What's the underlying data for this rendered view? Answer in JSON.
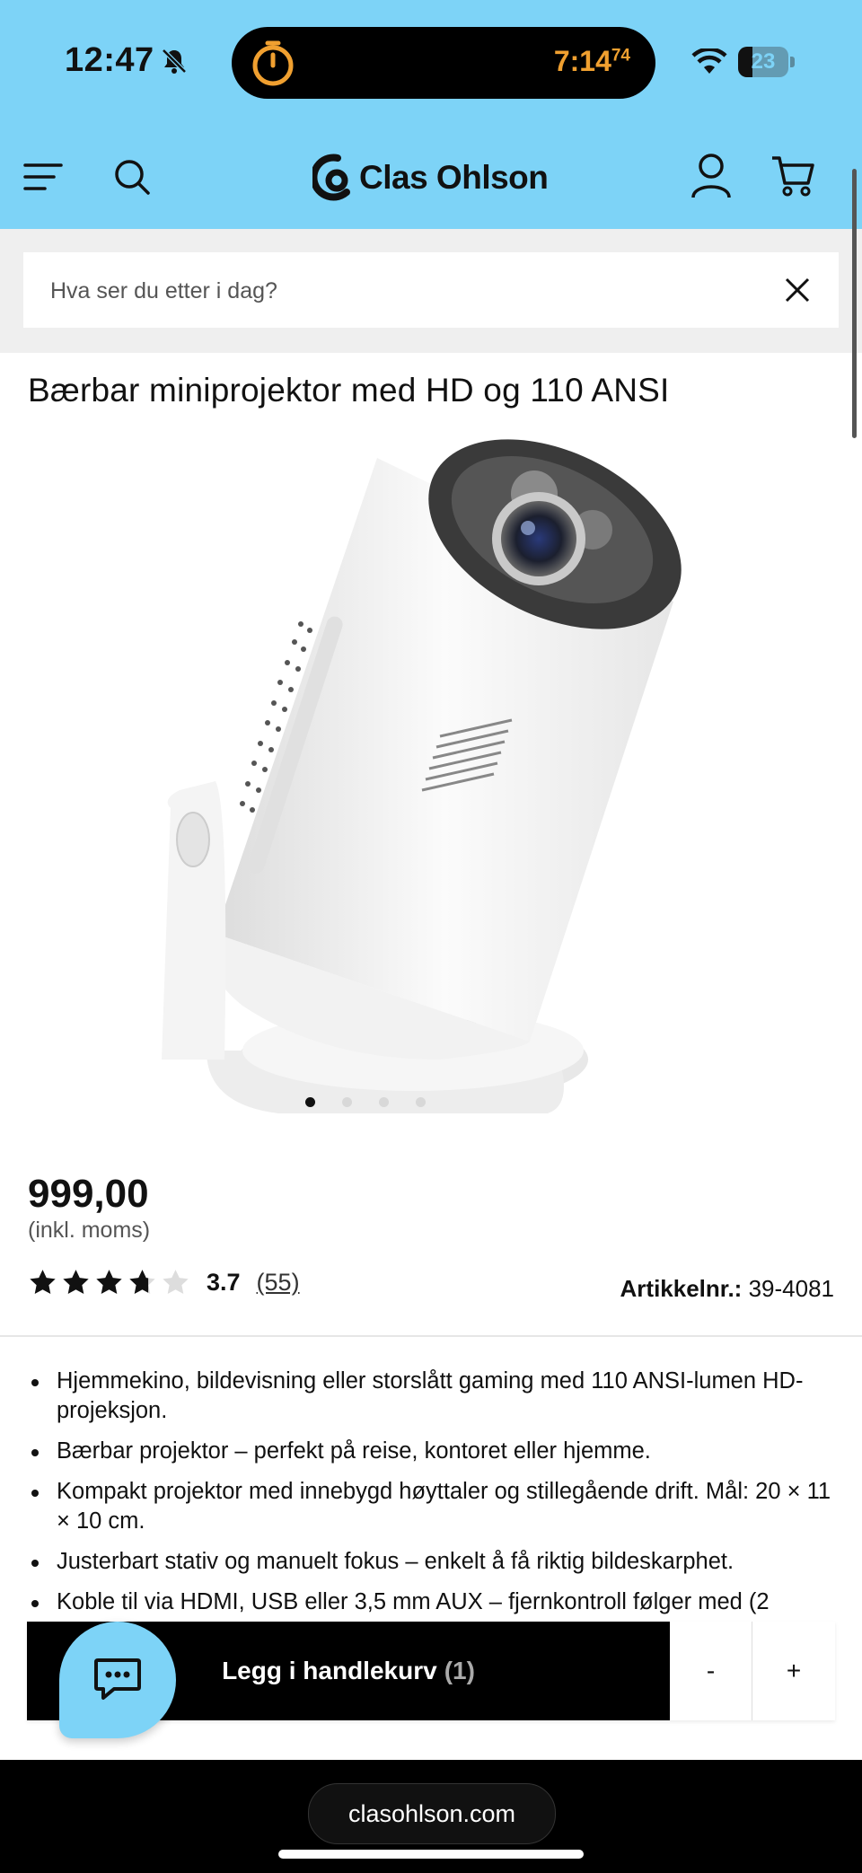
{
  "status_bar": {
    "time": "12:47",
    "timer": "7:14",
    "timer_fraction": "74",
    "battery": "23",
    "icons": [
      "bell-slash-icon",
      "timer-icon",
      "wifi-icon",
      "battery-icon"
    ]
  },
  "header": {
    "brand": "Clas Ohlson",
    "icons": [
      "menu-icon",
      "search-icon",
      "logo-icon",
      "account-icon",
      "cart-icon"
    ],
    "accent_color": "#7dd3f7"
  },
  "search": {
    "placeholder": "Hva ser du etter i dag?",
    "value": ""
  },
  "product": {
    "title": "Bærbar miniprojektor med HD og 110 ANSI",
    "price": "999,00",
    "vat_note": "(inkl. moms)",
    "rating_value": 3.7,
    "rating_label": "3.7",
    "rating_count": "(55)",
    "stars_max": 5,
    "article_label": "Artikkelnr.:",
    "article_number": "39-4081",
    "image_count": 4,
    "current_image": 1,
    "bullets": [
      "Hjemmekino, bildevisning eller storslått gaming med 110 ANSI-lumen HD-projeksjon.",
      "Bærbar projektor – perfekt på reise, kontoret eller hjemme.",
      "Kompakt projektor med innebygd høyttaler og stillegående drift. Mål: 20 × 11 × 10 cm.",
      "Justerbart stativ og manuelt fokus – enkelt å få riktig bildeskarphet.",
      "Koble til via HDMI, USB eller 3,5 mm AUX – fjernkontroll følger med (2"
    ]
  },
  "cart": {
    "button_label": "Legg i handlekurv",
    "quantity": "(1)",
    "minus": "-",
    "plus": "+"
  },
  "browser": {
    "url": "clasohlson.com"
  }
}
